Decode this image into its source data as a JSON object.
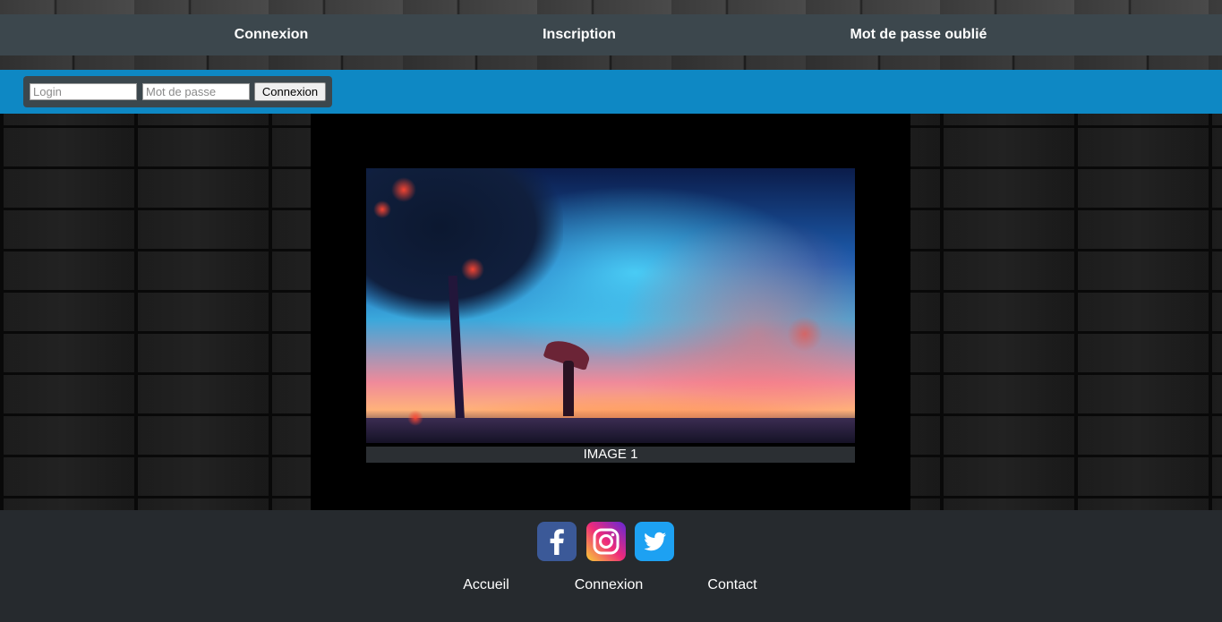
{
  "top_nav": {
    "items": [
      {
        "label": "Connexion"
      },
      {
        "label": "Inscription"
      },
      {
        "label": "Mot de passe oublié"
      }
    ]
  },
  "login_form": {
    "login_placeholder": "Login",
    "password_placeholder": "Mot de passe",
    "submit_label": "Connexion"
  },
  "slider": {
    "caption": "IMAGE 1"
  },
  "footer": {
    "social": [
      {
        "name": "facebook-icon",
        "color": "#3b5998"
      },
      {
        "name": "instagram-icon",
        "color": "#e1306c"
      },
      {
        "name": "twitter-icon",
        "color": "#1da1f2"
      }
    ],
    "links": [
      {
        "label": "Accueil"
      },
      {
        "label": "Connexion"
      },
      {
        "label": "Contact"
      }
    ]
  },
  "colors": {
    "nav_bg": "#3c474d",
    "login_bar_bg": "#0e88c4",
    "footer_bg": "#262a2e",
    "caption_bg": "#2b2f33"
  }
}
